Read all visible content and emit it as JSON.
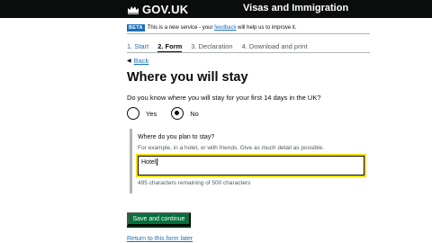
{
  "header": {
    "logo_text": "GOV.UK",
    "logo_icon": "crown-icon",
    "service_name": "Visas and Immigration"
  },
  "phase_banner": {
    "tag": "BETA",
    "text_before": "This is a new service - your ",
    "link_text": "feedback",
    "text_after": " will help us to improve it."
  },
  "steps": [
    {
      "label": "1. Start",
      "state": "link"
    },
    {
      "label": "2. Form",
      "state": "active"
    },
    {
      "label": "3. Declaration",
      "state": "inactive"
    },
    {
      "label": "4. Download and print",
      "state": "inactive"
    }
  ],
  "back_link": "Back",
  "title": "Where you will stay",
  "question": "Do you know where you will stay for your first 14 days in the UK?",
  "radios": [
    {
      "label": "Yes",
      "checked": false
    },
    {
      "label": "No",
      "checked": true
    }
  ],
  "conditional": {
    "label": "Where do you plan to stay?",
    "hint": "For example, in a hotel, or with friends. Give as much detail as possible.",
    "value": "Hotel",
    "counter": "495 characters remaining of 500 characters"
  },
  "submit_button": "Save and continue",
  "return_link": "Return to this form later",
  "colors": {
    "header_bg": "#0b0c0c",
    "link": "#1d70b8",
    "button": "#00703c",
    "focus": "#ffdd00"
  }
}
